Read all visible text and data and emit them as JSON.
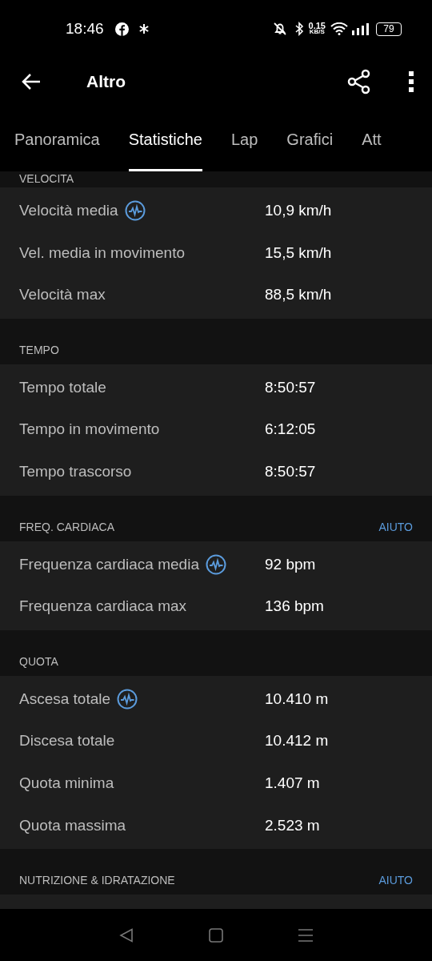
{
  "status_bar": {
    "time": "18:46",
    "speed_value": "0.15",
    "speed_unit": "KB/S",
    "battery": "79"
  },
  "app_bar": {
    "title": "Altro"
  },
  "tabs": [
    {
      "label": "Panoramica",
      "selected": false
    },
    {
      "label": "Statistiche",
      "selected": true
    },
    {
      "label": "Lap",
      "selected": false
    },
    {
      "label": "Grafici",
      "selected": false
    },
    {
      "label": "Att",
      "selected": false
    }
  ],
  "sections": [
    {
      "title": "VELOCITA",
      "rows": [
        {
          "label": "Velocità media",
          "value": "10,9 km/h",
          "icon": true
        },
        {
          "label": "Vel. media in movimento",
          "value": "15,5 km/h",
          "icon": false
        },
        {
          "label": "Velocità max",
          "value": "88,5 km/h",
          "icon": false
        }
      ]
    },
    {
      "title": "TEMPO",
      "rows": [
        {
          "label": "Tempo totale",
          "value": "8:50:57",
          "icon": false
        },
        {
          "label": "Tempo in movimento",
          "value": "6:12:05",
          "icon": false
        },
        {
          "label": "Tempo trascorso",
          "value": "8:50:57",
          "icon": false
        }
      ]
    },
    {
      "title": "FREQ. CARDIACA",
      "help": "AIUTO",
      "rows": [
        {
          "label": "Frequenza cardiaca media",
          "value": "92 bpm",
          "icon": true
        },
        {
          "label": "Frequenza cardiaca max",
          "value": "136 bpm",
          "icon": false
        }
      ]
    },
    {
      "title": "QUOTA",
      "rows": [
        {
          "label": "Ascesa totale",
          "value": "10.410 m",
          "icon": true
        },
        {
          "label": "Discesa totale",
          "value": "10.412 m",
          "icon": false
        },
        {
          "label": "Quota minima",
          "value": "1.407 m",
          "icon": false
        },
        {
          "label": "Quota massima",
          "value": "2.523 m",
          "icon": false
        }
      ]
    },
    {
      "title": "NUTRIZIONE & IDRATAZIONE",
      "help": "AIUTO"
    }
  ]
}
